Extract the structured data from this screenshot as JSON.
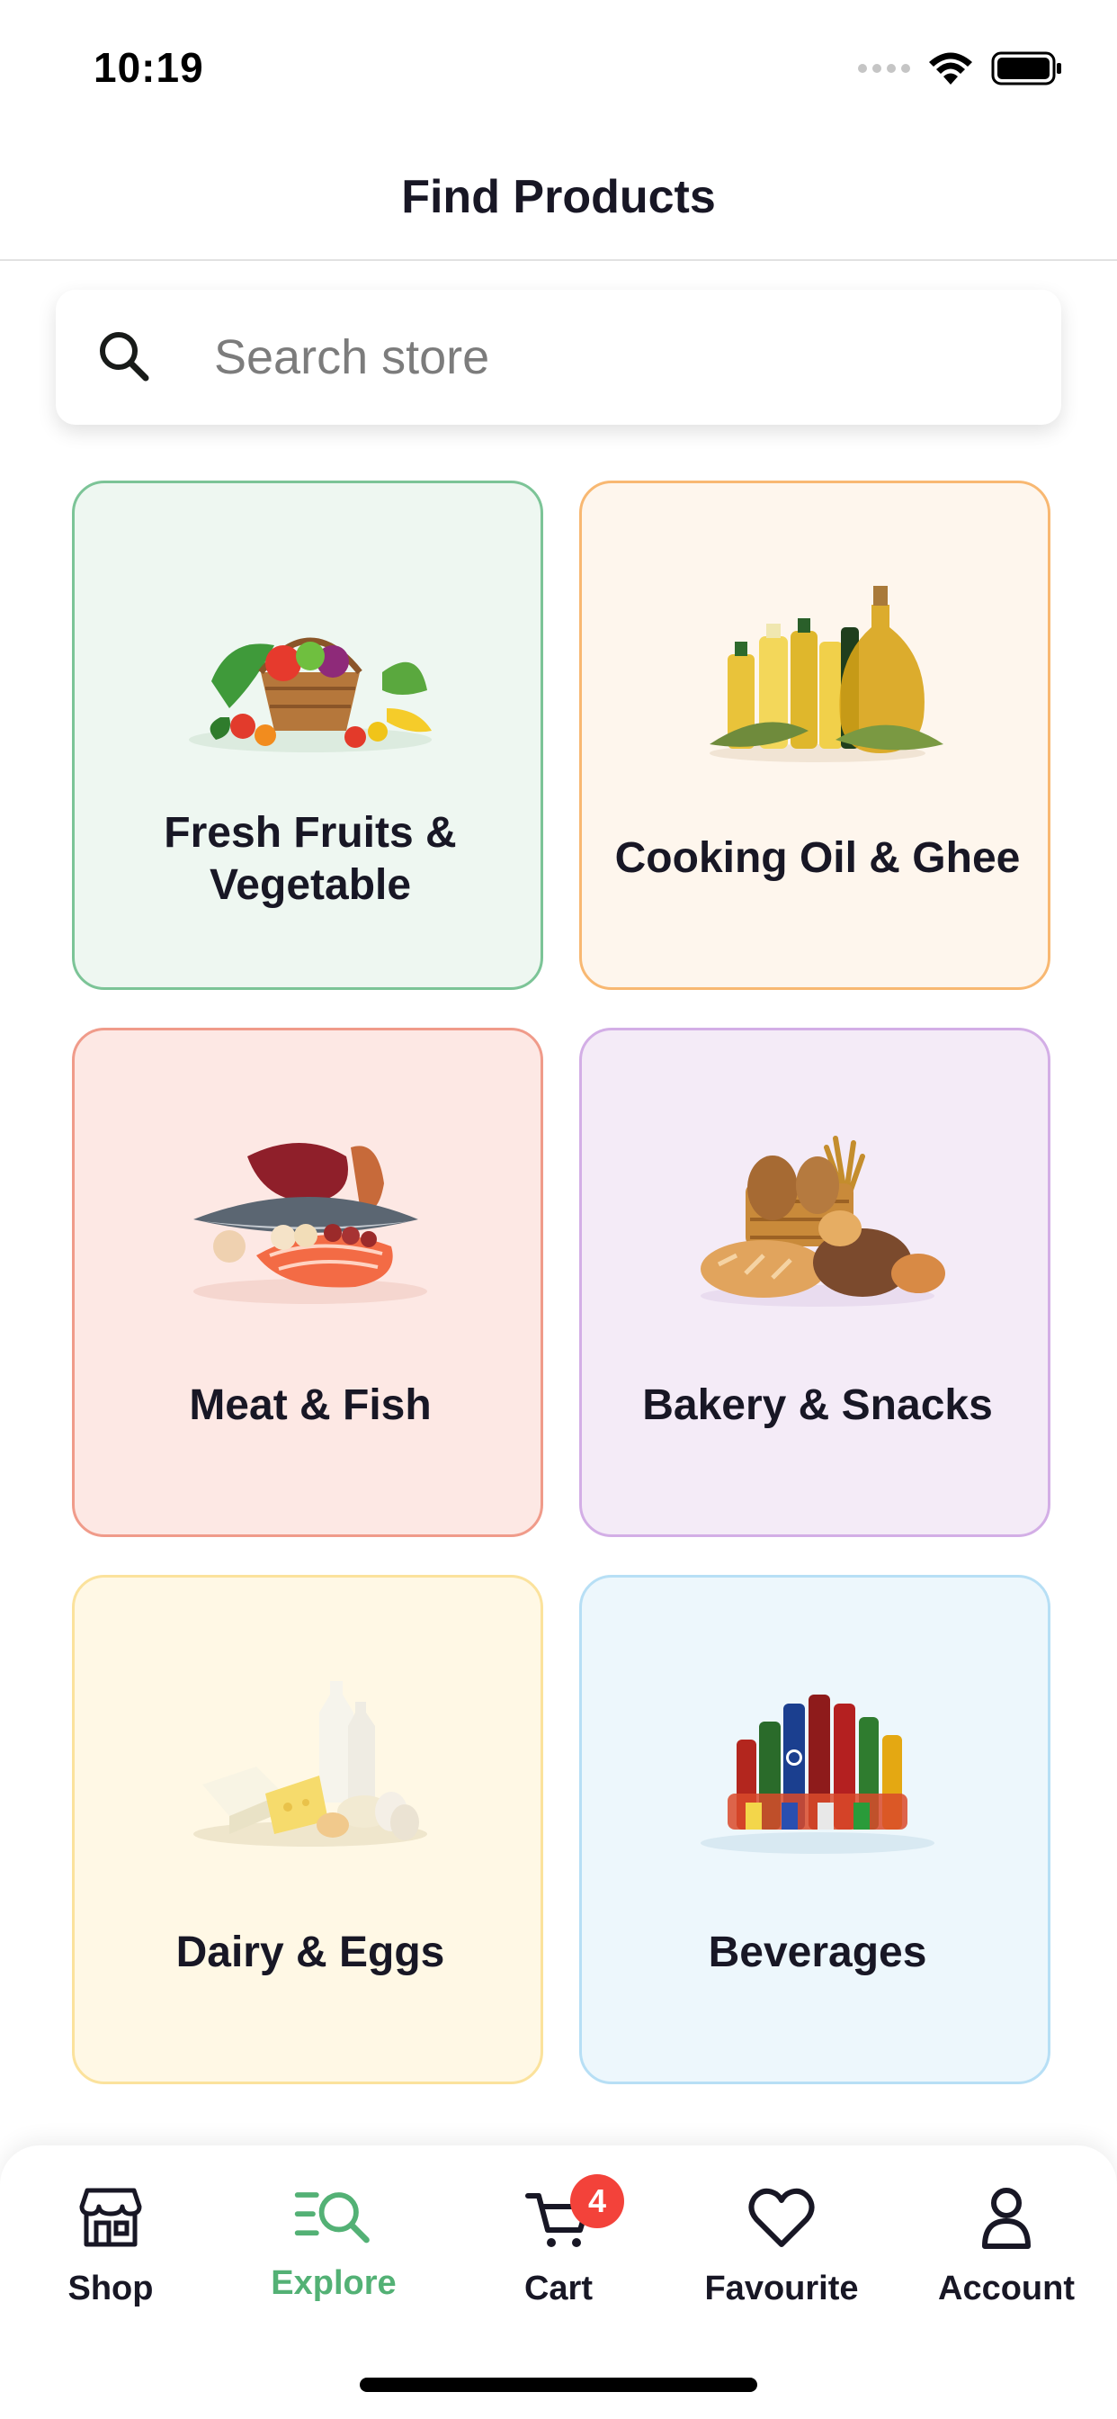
{
  "status_bar": {
    "time": "10:19"
  },
  "header": {
    "title": "Find Products"
  },
  "search": {
    "placeholder": "Search store",
    "value": ""
  },
  "categories": [
    {
      "label": "Fresh Fruits & Vegetable",
      "line1": "Fresh Fruits &",
      "line2": "Vegetable",
      "bg": "#eef7f1",
      "border": "#7cc497",
      "icon": "fruit-basket-icon"
    },
    {
      "label": "Cooking Oil & Ghee",
      "bg": "#fef6ed",
      "border": "#f8b872",
      "icon": "oil-bottles-icon"
    },
    {
      "label": "Meat & Fish",
      "bg": "#fde8e4",
      "border": "#f09b8a",
      "icon": "meat-fish-icon"
    },
    {
      "label": "Bakery & Snacks",
      "bg": "#f4ebf7",
      "border": "#d3aee6",
      "icon": "bread-icon"
    },
    {
      "label": "Dairy & Eggs",
      "bg": "#fff8e5",
      "border": "#fbe29c",
      "icon": "dairy-icon"
    },
    {
      "label": "Beverages",
      "bg": "#edf7fc",
      "border": "#b7dff5",
      "icon": "beverage-bottles-icon"
    }
  ],
  "tabbar": {
    "tabs": [
      {
        "label": "Shop",
        "icon": "store-icon"
      },
      {
        "label": "Explore",
        "icon": "explore-search-icon",
        "active": true
      },
      {
        "label": "Cart",
        "icon": "cart-icon",
        "badge": "4"
      },
      {
        "label": "Favourite",
        "icon": "heart-icon"
      },
      {
        "label": "Account",
        "icon": "user-icon"
      }
    ]
  },
  "colors": {
    "accent": "#53b175",
    "badge": "#f3423a",
    "text": "#181725"
  }
}
